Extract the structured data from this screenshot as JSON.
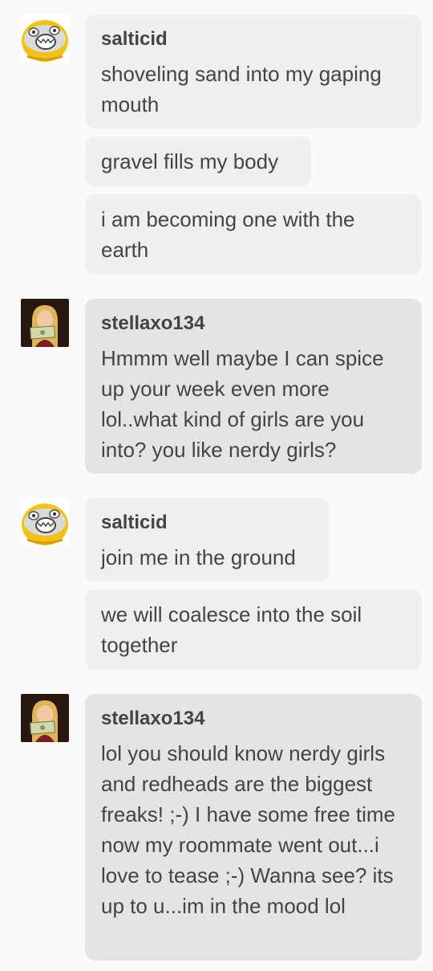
{
  "users": {
    "salticid": {
      "name": "salticid",
      "avatar_icon": "yellow-screaming-creature-avatar"
    },
    "stellaxo134": {
      "name": "stellaxo134",
      "avatar_icon": "blonde-woman-holding-dollar-avatar"
    }
  },
  "messages": [
    {
      "sender": "salticid",
      "text": "shoveling sand into my gaping mouth"
    },
    {
      "text": "gravel fills my body"
    },
    {
      "text": "i am becoming one with the earth"
    },
    {
      "sender": "stellaxo134",
      "text": "Hmmm well maybe I can spice up your week even more lol..what kind of girls are you into? you like nerdy girls?"
    },
    {
      "sender": "salticid",
      "text": "join me in the ground"
    },
    {
      "text": "we will coalesce into the soil together"
    },
    {
      "sender": "stellaxo134",
      "text": "lol you should know nerdy girls and redheads are the biggest freaks! ;-) I have some free time now my roommate went out...i love to tease ;-) Wanna see? its up to u...im in the mood lol"
    }
  ],
  "colors": {
    "page_background": "#fafafa",
    "bubble_light": "#efefef",
    "bubble_dark": "#e4e4e4",
    "text": "#444444"
  }
}
